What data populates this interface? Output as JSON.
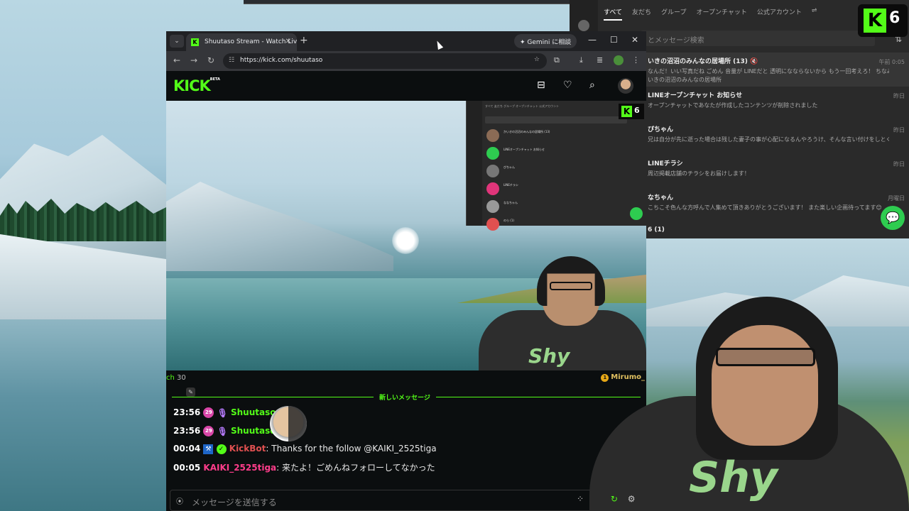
{
  "line": {
    "tabs": [
      "すべて",
      "友だち",
      "グループ",
      "オープンチャット",
      "公式アカウント"
    ],
    "search_placeholder": "とメッセージ検索",
    "chats": [
      {
        "name": "いきの沼沼のみんなの居場所 (13) 🔇",
        "preview": "なんだ！いい写真だね ごめん 音量が LINEだと 透明になならないから もう一回考えろ！ ちなみにスマホ...",
        "sub": "いきの沼沼のみんなの居場所",
        "time": "午前 0:05"
      },
      {
        "name": "LINEオープンチャット お知らせ",
        "preview": "オープンチャットであなたが作成したコンテンツが削除されました",
        "time": "昨日"
      },
      {
        "name": "ぴちゃん",
        "preview": "兄は自分が先に逝った場合は残した妻子の事が心配になるんやろうけ、そんな言い付けをしとくのはデフォかもし",
        "time": "昨日"
      },
      {
        "name": "LINEチラシ",
        "preview": "周辺掲載店舗のチラシをお届けします！",
        "time": "昨日"
      },
      {
        "name": "なちゃん",
        "preview": "こちこそ色んな方呼んで人集めて頂きありがとうございます！ また楽しい企画待ってます😊",
        "time": "月曜日"
      },
      {
        "name": "6 (1)",
        "preview": "",
        "time": ""
      }
    ]
  },
  "kick_badge": {
    "letter": "K",
    "count": "6"
  },
  "browser": {
    "tab_title": "Shuutaso Stream - Watch Live o",
    "gemini_label": "Gemini に相談",
    "url": "https://kick.com/shuutaso"
  },
  "kick": {
    "logo": "KICK",
    "logo_sup": "BETA"
  },
  "mini_line": {
    "tabs": "すべて  友だち  グループ  オープンチャット  公式アカウント",
    "rows": [
      "かいきの沼沼のみんなの居場所 (13)",
      "LINEオープンチャット お知らせ",
      "ぴちゃん",
      "LINEチラシ",
      "ななちゃん",
      "のら (1)"
    ]
  },
  "stream": {
    "viewers_prefix": "ch",
    "viewers": "30",
    "right_user": "Mirumo_"
  },
  "chat": {
    "new_messages_label": "新しいメッセージ",
    "messages": [
      {
        "time": "23:56",
        "badge": "29",
        "user": "Shuutaso",
        "text": ""
      },
      {
        "time": "23:56",
        "badge": "29",
        "user": "Shuutaso",
        "text": ""
      },
      {
        "time": "00:04",
        "badge": "",
        "user": "KickBot",
        "text": " Thanks for the follow @KAIKI_2525tiga"
      },
      {
        "time": "00:05",
        "badge": "",
        "user": "KAIKI_2525tiga",
        "text": " 来たよ！ごめんねフォローしてなかった"
      }
    ],
    "input_placeholder": "メッセージを送信する"
  },
  "colors": {
    "kick_green": "#53fc18",
    "line_green": "#2ecc50",
    "chat_bg": "#0b0e0f"
  }
}
